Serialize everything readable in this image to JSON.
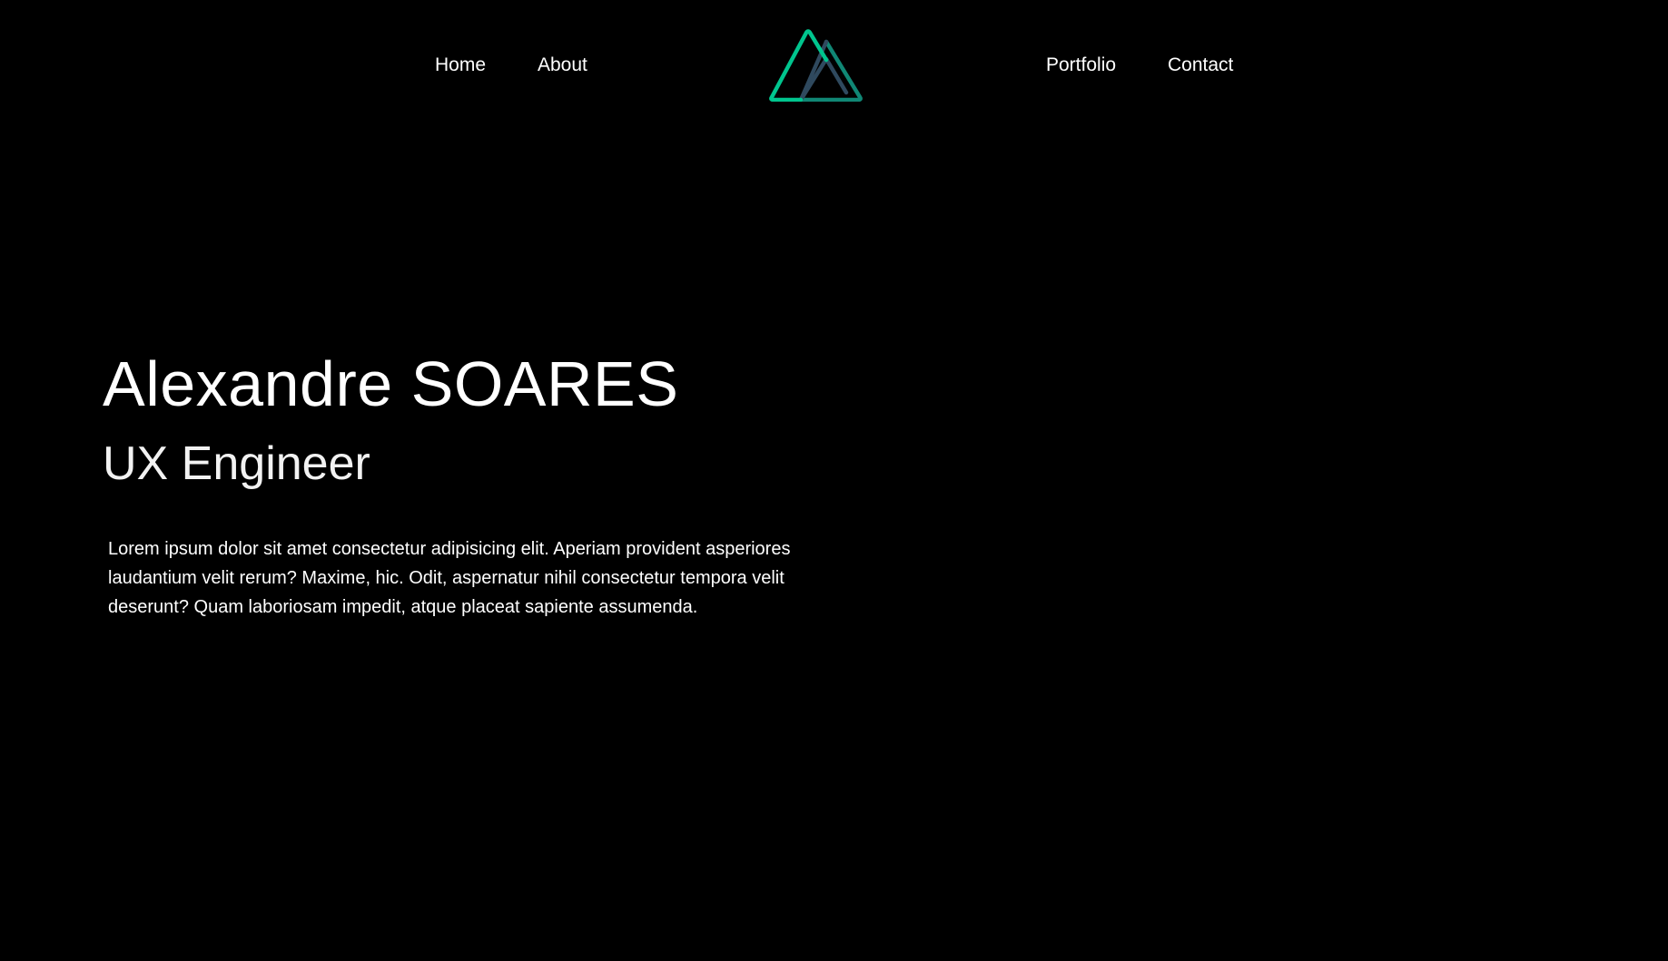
{
  "nav": {
    "home": "Home",
    "about": "About",
    "portfolio": "Portfolio",
    "contact": "Contact"
  },
  "logo": {
    "icon": "mountain-logo-icon",
    "colors": {
      "outer": "#00C58E",
      "inner": "#2F495E",
      "accent": "#108775"
    }
  },
  "hero": {
    "name": "Alexandre SOARES",
    "role": "UX Engineer",
    "description": "Lorem ipsum dolor sit amet consectetur adipisicing elit. Aperiam provident asperiores laudantium velit rerum? Maxime, hic. Odit, aspernatur nihil consectetur tempora velit deserunt? Quam laboriosam impedit, atque placeat sapiente assumenda."
  },
  "theme": {
    "background": "#000000",
    "text": "#FFFFFF"
  }
}
